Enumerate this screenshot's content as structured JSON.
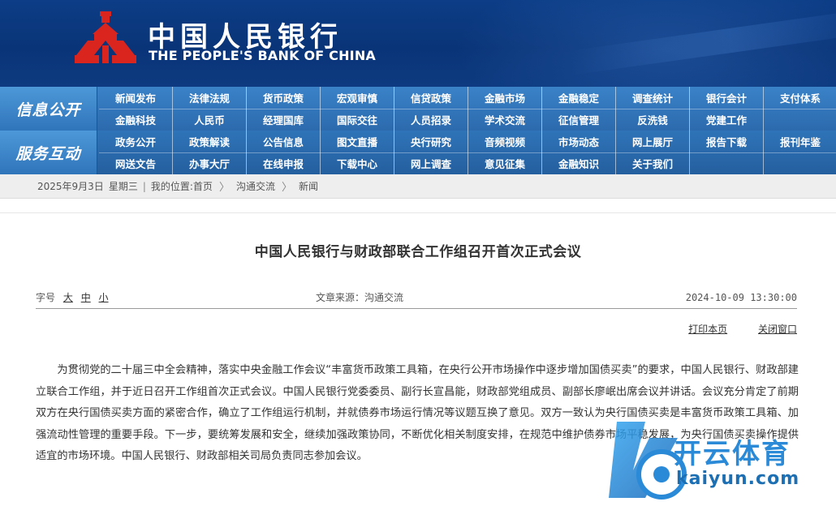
{
  "header": {
    "bank_name_cn": "中国人民银行",
    "bank_name_en": "THE PEOPLE'S BANK OF CHINA",
    "logo_icon": "pboc-logo-icon"
  },
  "nav": {
    "section1": {
      "label": "信息公开",
      "items": [
        "新闻发布",
        "法律法规",
        "货币政策",
        "宏观审慎",
        "信贷政策",
        "金融市场",
        "金融稳定",
        "调查统计",
        "银行会计",
        "支付体系",
        "金融科技",
        "人民币",
        "经理国库",
        "国际交往",
        "人员招录",
        "学术交流",
        "征信管理",
        "反洗钱",
        "党建工作",
        ""
      ]
    },
    "section2": {
      "label": "服务互动",
      "items": [
        "政务公开",
        "政策解读",
        "公告信息",
        "图文直播",
        "央行研究",
        "音频视频",
        "市场动态",
        "网上展厅",
        "报告下载",
        "报刊年鉴",
        "网送文告",
        "办事大厅",
        "在线申报",
        "下载中心",
        "网上调查",
        "意见征集",
        "金融知识",
        "关于我们",
        "",
        ""
      ]
    }
  },
  "breadcrumb": {
    "date": "2025年9月3日",
    "weekday": "星期三",
    "location_label": "我的位置:",
    "home": "首页",
    "level1": "沟通交流",
    "level2": "新闻"
  },
  "article": {
    "title": "中国人民银行与财政部联合工作组召开首次正式会议",
    "font_size_label": "字号",
    "size_large": "大",
    "size_medium": "中",
    "size_small": "小",
    "source": "文章来源：沟通交流",
    "datetime": "2024-10-09 13:30:00",
    "print_label": "打印本页",
    "close_label": "关闭窗口",
    "body": "为贯彻党的二十届三中全会精神，落实中央金融工作会议“丰富货币政策工具箱，在央行公开市场操作中逐步增加国债买卖”的要求，中国人民银行、财政部建立联合工作组，并于近日召开工作组首次正式会议。中国人民银行党委委员、副行长宣昌能，财政部党组成员、副部长廖岷出席会议并讲话。会议充分肯定了前期双方在央行国债买卖方面的紧密合作，确立了工作组运行机制，并就债券市场运行情况等议题互换了意见。双方一致认为央行国债买卖是丰富货币政策工具箱、加强流动性管理的重要手段。下一步，要统筹发展和安全，继续加强政策协同，不断优化相关制度安排，在规范中维护债券市场平稳发展，为央行国债买卖操作提供适宜的市场环境。中国人民银行、财政部相关司局负责同志参加会议。"
  },
  "watermark": {
    "brand_cn": "开云体育",
    "brand_en": "kaiyun.com"
  },
  "colors": {
    "banner": "#0c3d86",
    "nav": "#2e6fb2",
    "logo_red": "#d9251d"
  }
}
